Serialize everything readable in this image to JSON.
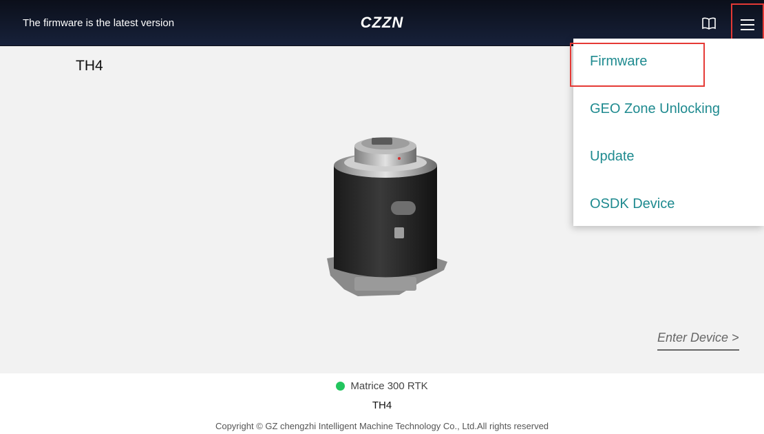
{
  "header": {
    "status_text": "The firmware is the latest version",
    "brand": "CZZN",
    "manual_icon": "book-open-icon",
    "menu_icon": "hamburger-menu-icon"
  },
  "main": {
    "device_name": "TH4",
    "enter_device_label": "Enter Device >"
  },
  "menu": {
    "items": [
      {
        "label": "Firmware",
        "highlighted": true
      },
      {
        "label": "GEO Zone Unlocking"
      },
      {
        "label": "Update"
      },
      {
        "label": "OSDK Device"
      }
    ]
  },
  "footer": {
    "aircraft_model": "Matrice 300 RTK",
    "connection_status_color": "#22c55e",
    "device_model": "TH4",
    "copyright": "Copyright © GZ chengzhi Intelligent Machine Technology Co., Ltd.All rights reserved"
  },
  "colors": {
    "header_bg": "#0b0f1a",
    "menu_text": "#1e8a8f",
    "highlight": "#e53935"
  }
}
